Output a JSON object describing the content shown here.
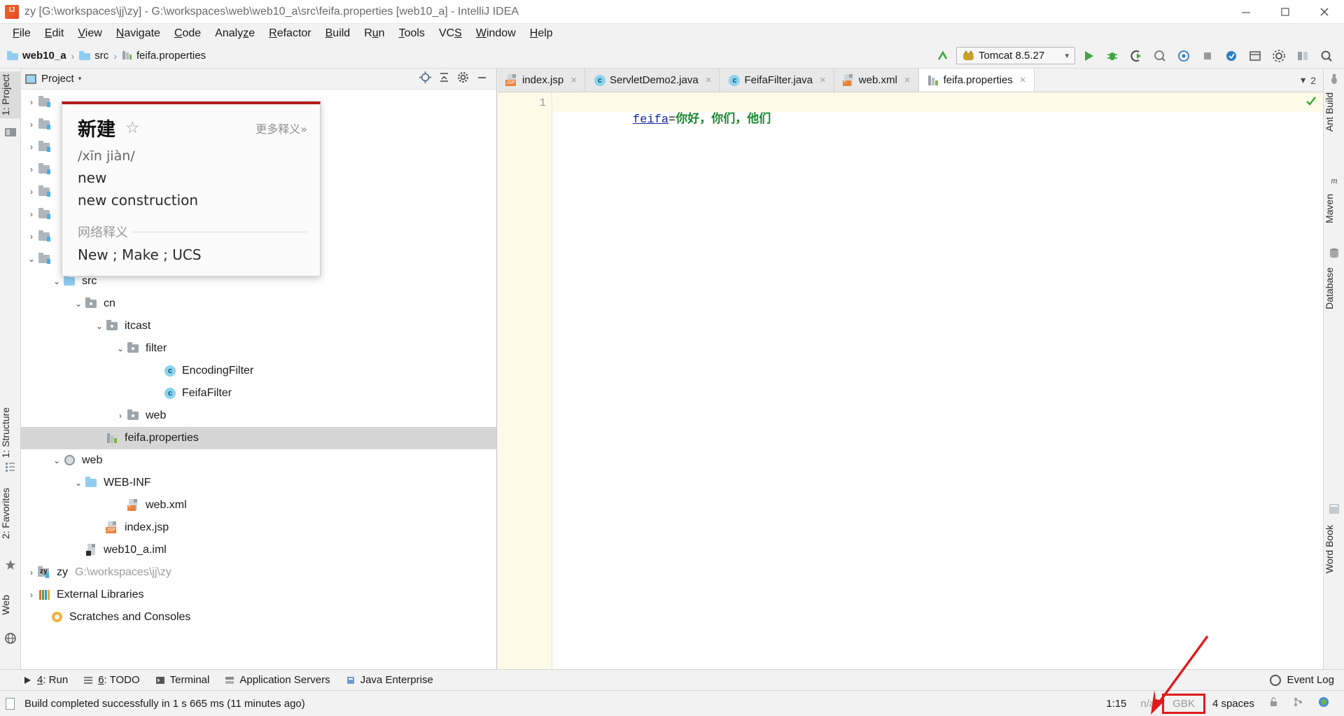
{
  "window": {
    "title": "zy [G:\\workspaces\\jj\\zy] - G:\\workspaces\\web\\web10_a\\src\\feifa.properties [web10_a] - IntelliJ IDEA",
    "app_icon": "intellij-idea-icon",
    "minimize_label": "Minimize",
    "maximize_label": "Maximize",
    "close_label": "Close"
  },
  "menu": {
    "items": [
      {
        "label": "File",
        "mnemonic": "F"
      },
      {
        "label": "Edit",
        "mnemonic": "E"
      },
      {
        "label": "View",
        "mnemonic": "V"
      },
      {
        "label": "Navigate",
        "mnemonic": "N"
      },
      {
        "label": "Code",
        "mnemonic": "C"
      },
      {
        "label": "Analyze",
        "mnemonic": "z"
      },
      {
        "label": "Refactor",
        "mnemonic": "R"
      },
      {
        "label": "Build",
        "mnemonic": "B"
      },
      {
        "label": "Run",
        "mnemonic": "u"
      },
      {
        "label": "Tools",
        "mnemonic": "T"
      },
      {
        "label": "VCS",
        "mnemonic": "S"
      },
      {
        "label": "Window",
        "mnemonic": "W"
      },
      {
        "label": "Help",
        "mnemonic": "H"
      }
    ]
  },
  "breadcrumb": {
    "items": [
      {
        "label": "web10_a",
        "icon": "folder-icon",
        "bold": true
      },
      {
        "label": "src",
        "icon": "folder-icon",
        "bold": false
      },
      {
        "label": "feifa.properties",
        "icon": "properties-file-icon",
        "bold": false
      }
    ],
    "separator": "›"
  },
  "toolbar": {
    "build_label": "Build",
    "run_config": {
      "label": "Tomcat 8.5.27",
      "icon": "tomcat-cat-icon",
      "chevron": "∨"
    },
    "buttons": [
      {
        "name": "run-button",
        "icon": "play-icon",
        "color": "#3ea73e"
      },
      {
        "name": "debug-button",
        "icon": "bug-icon",
        "color": "#3ea73e"
      },
      {
        "name": "run-with-coverage-button",
        "icon": "coverage-icon",
        "color": "#4c4c4c"
      },
      {
        "name": "profile-button",
        "icon": "profiler-icon",
        "color": "#7a7a7a"
      },
      {
        "name": "attach-debugger-button",
        "icon": "attach-icon",
        "color": "#2b7fc4"
      },
      {
        "name": "stop-button",
        "icon": "stop-square-icon",
        "color": "#8c8c8c"
      },
      {
        "name": "update-app-button",
        "icon": "refresh-circle-icon",
        "color": "#2b7fc4"
      },
      {
        "name": "open-browser-button",
        "icon": "browser-icon",
        "color": "#4c4c4c"
      },
      {
        "name": "settings-button",
        "icon": "gear-icon",
        "color": "#4c4c4c"
      },
      {
        "name": "project-structure-button",
        "icon": "project-structure-icon",
        "color": "#4c4c4c"
      },
      {
        "name": "search-everywhere-button",
        "icon": "search-icon",
        "color": "#4c4c4c"
      }
    ]
  },
  "left_strip": {
    "tabs": [
      {
        "label": "1: Project",
        "icon": "project-tool-icon",
        "selected": true
      },
      {
        "label": "1: Structure",
        "icon": "structure-tool-icon",
        "selected": false
      },
      {
        "label": "2: Favorites",
        "icon": "favorites-star-icon",
        "selected": false
      },
      {
        "label": "Web",
        "icon": "web-globe-icon",
        "selected": false
      }
    ]
  },
  "right_strip": {
    "tabs": [
      {
        "label": "Ant Build",
        "icon": "ant-build-icon"
      },
      {
        "label": "Maven",
        "icon": "maven-m-icon"
      },
      {
        "label": "Database",
        "icon": "database-icon"
      },
      {
        "label": "Word Book",
        "icon": "word-book-icon"
      }
    ]
  },
  "project_panel": {
    "header_title": "Project",
    "header_caret": "▾",
    "header_buttons": [
      {
        "name": "scroll-from-source-button",
        "icon": "target-icon"
      },
      {
        "name": "collapse-all-button",
        "icon": "collapse-all-icon"
      },
      {
        "name": "panel-settings-button",
        "icon": "gear-icon"
      },
      {
        "name": "hide-panel-button",
        "icon": "minus-icon"
      }
    ],
    "tree": [
      {
        "label": "",
        "icon": "module-icon",
        "indent": 0,
        "arrow": "›",
        "hidden_by_popup": true
      },
      {
        "label": "",
        "icon": "module-icon",
        "indent": 0,
        "arrow": "›",
        "hidden_by_popup": true
      },
      {
        "label": "",
        "icon": "module-icon",
        "indent": 0,
        "arrow": "›",
        "hidden_by_popup": true
      },
      {
        "label": "",
        "icon": "module-icon",
        "indent": 0,
        "arrow": "›",
        "hidden_by_popup": true
      },
      {
        "label": "",
        "icon": "module-icon",
        "indent": 0,
        "arrow": "›",
        "hidden_by_popup": true
      },
      {
        "label": "",
        "icon": "module-icon",
        "indent": 0,
        "arrow": "›",
        "hidden_by_popup": true
      },
      {
        "label": "",
        "icon": "module-icon",
        "indent": 0,
        "arrow": "›",
        "hidden_by_popup": true
      },
      {
        "label": "",
        "icon": "module-icon",
        "indent": 0,
        "arrow": "∨",
        "hidden_by_popup": true
      },
      {
        "label": "src",
        "icon": "source-folder-icon",
        "indent": 1,
        "arrow": "∨",
        "selected": false
      },
      {
        "label": "cn",
        "icon": "package-icon",
        "indent": 2,
        "arrow": "∨",
        "selected": false
      },
      {
        "label": "itcast",
        "icon": "package-icon",
        "indent": 3,
        "arrow": "∨",
        "selected": false
      },
      {
        "label": "filter",
        "icon": "package-icon",
        "indent": 4,
        "arrow": "∨",
        "selected": false
      },
      {
        "label": "EncodingFilter",
        "icon": "java-class-icon",
        "indent": 5,
        "arrow": "",
        "selected": false
      },
      {
        "label": "FeifaFilter",
        "icon": "java-class-icon",
        "indent": 5,
        "arrow": "",
        "selected": false
      },
      {
        "label": "web",
        "icon": "package-icon",
        "indent": 4,
        "arrow": "›",
        "selected": false
      },
      {
        "label": "feifa.properties",
        "icon": "properties-file-icon",
        "indent": 3,
        "arrow": "",
        "selected": true
      },
      {
        "label": "web",
        "icon": "web-folder-icon",
        "indent": 1,
        "arrow": "∨",
        "selected": false
      },
      {
        "label": "WEB-INF",
        "icon": "folder-icon",
        "indent": 2,
        "arrow": "∨",
        "selected": false
      },
      {
        "label": "web.xml",
        "icon": "xml-file-icon",
        "indent": 3,
        "arrow": "",
        "selected": false
      },
      {
        "label": "index.jsp",
        "icon": "jsp-file-icon",
        "indent": 2,
        "arrow": "",
        "selected": false
      },
      {
        "label": "web10_a.iml",
        "icon": "iml-file-icon",
        "indent": 2,
        "arrow": "",
        "selected": false
      },
      {
        "label": "zy",
        "icon": "module-zy-icon",
        "indent": 0,
        "arrow": "›",
        "suffix": "G:\\workspaces\\jj\\zy",
        "selected": false
      },
      {
        "label": "External Libraries",
        "icon": "libraries-icon",
        "indent": 0,
        "arrow": "›",
        "selected": false
      },
      {
        "label": "Scratches and Consoles",
        "icon": "scratches-icon",
        "indent": 0,
        "arrow": "",
        "selected": false
      }
    ]
  },
  "dictionary_popup": {
    "word": "新建",
    "star_icon": "star-outline-icon",
    "more_link": "更多释义»",
    "pinyin": "/xīn jiàn/",
    "definitions": [
      "new",
      "new construction"
    ],
    "web_section_label": "网络释义",
    "web_definitions": "New ; Make ; UCS"
  },
  "editor": {
    "tabs": [
      {
        "label": "index.jsp",
        "icon": "jsp-file-icon",
        "active": false,
        "close": "×"
      },
      {
        "label": "ServletDemo2.java",
        "icon": "java-class-icon",
        "active": false,
        "close": "×"
      },
      {
        "label": "FeifaFilter.java",
        "icon": "java-class-icon",
        "active": false,
        "close": "×"
      },
      {
        "label": "web.xml",
        "icon": "xml-file-icon",
        "active": false,
        "close": "×"
      },
      {
        "label": "feifa.properties",
        "icon": "properties-file-icon",
        "active": true,
        "close": "×"
      }
    ],
    "tab_overflow_icon": "chevron-down-icon",
    "tab_count_badge": "2",
    "line_number": "1",
    "code": {
      "key": "feifa",
      "equals": "=",
      "value": "你好，你们，他们"
    },
    "inspection_status_icon": "checkmark-icon",
    "inspection_status_color": "#2cac2c"
  },
  "bottom_bar": {
    "items": [
      {
        "label": "4: Run",
        "mnemonic": "4",
        "icon": "play-icon"
      },
      {
        "label": "6: TODO",
        "mnemonic": "6",
        "icon": "todo-list-icon"
      },
      {
        "label": "Terminal",
        "icon": "terminal-icon"
      },
      {
        "label": "Application Servers",
        "icon": "app-servers-icon"
      },
      {
        "label": "Java Enterprise",
        "icon": "java-enterprise-icon"
      }
    ],
    "event_log": {
      "label": "Event Log",
      "icon": "event-log-icon"
    }
  },
  "status_bar": {
    "message": "Build completed successfully in 1 s 665 ms (11 minutes ago)",
    "doc_icon": "document-icon",
    "caret_position": "1:15",
    "line_separator": "n/a",
    "encoding": "GBK",
    "indent": "4 spaces",
    "lock_icon": "unlocked-icon",
    "vcs_icon": "vcs-branch-icon",
    "memory_icon": "memory-indicator",
    "encoding_highlight_color": "#e01b1b"
  },
  "annotation": {
    "arrow": {
      "color": "#e01b1b",
      "points_to": "encoding-status-GBK"
    }
  }
}
